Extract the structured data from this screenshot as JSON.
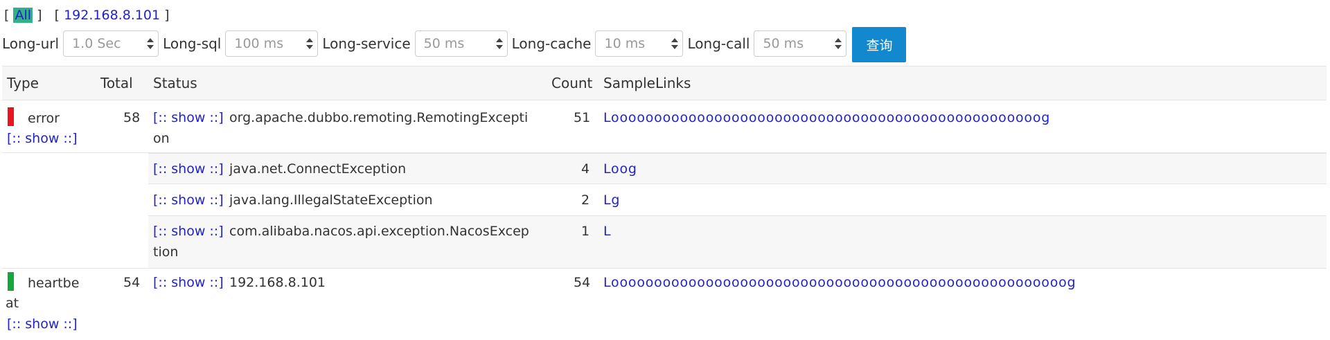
{
  "filter": {
    "open_bracket_1": "[",
    "all_label": "All",
    "close_bracket_1": "]",
    "open_bracket_2": "[",
    "ip_label": "192.168.8.101",
    "close_bracket_2": "]"
  },
  "controls": {
    "long_url": {
      "label": "Long-url",
      "value": "1.0 Sec"
    },
    "long_sql": {
      "label": "Long-sql",
      "value": "100 ms"
    },
    "long_service": {
      "label": "Long-service",
      "value": "50 ms"
    },
    "long_cache": {
      "label": "Long-cache",
      "value": "10 ms"
    },
    "long_call": {
      "label": "Long-call",
      "value": "50 ms"
    },
    "query_label": "查询"
  },
  "table": {
    "headers": {
      "type": "Type",
      "total": "Total",
      "status": "Status",
      "count": "Count",
      "samplelinks": "SampleLinks"
    },
    "show_label": "[:: show ::]",
    "error_group": {
      "type": "error",
      "type_color": "#e8141e",
      "total": "58",
      "rows": [
        {
          "status_line1": "org.apache.dubbo.remoting.RemotingExcepti",
          "status_line2": "on",
          "count": "51",
          "links": "Loooooooooooooooooooooooooooooooooooooooooooooooooog"
        },
        {
          "status_line1": "java.net.ConnectException",
          "status_line2": "",
          "count": "4",
          "links": "Loog"
        },
        {
          "status_line1": "java.lang.IllegalStateException",
          "status_line2": "",
          "count": "2",
          "links": "Lg"
        },
        {
          "status_line1": "com.alibaba.nacos.api.exception.NacosExcep",
          "status_line2": "tion",
          "count": "1",
          "links": "L"
        }
      ]
    },
    "heartbeat_group": {
      "type_line1": "heartbe",
      "type_line2": "at",
      "type_color": "#14a83c",
      "total": "54",
      "status": "192.168.8.101",
      "count": "54",
      "links": "Looooooooooooooooooooooooooooooooooooooooooooooooooooog"
    }
  }
}
